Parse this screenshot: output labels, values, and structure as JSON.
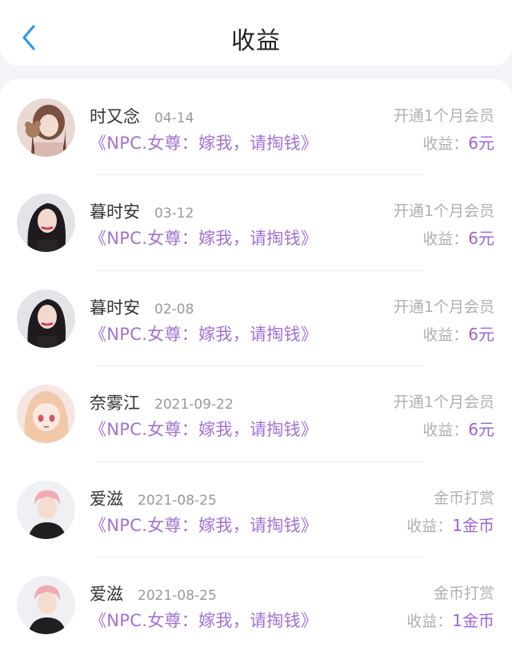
{
  "header": {
    "title": "收益"
  },
  "earn_label": "收益：",
  "records": [
    {
      "name": "时又念",
      "date": "04-14",
      "book": "《NPC.女尊：嫁我，请掏钱》",
      "type": "开通1个月会员",
      "amount": "6元",
      "avatar": "girl-with-teddy-bear"
    },
    {
      "name": "暮时安",
      "date": "03-12",
      "book": "《NPC.女尊：嫁我，请掏钱》",
      "type": "开通1个月会员",
      "amount": "6元",
      "avatar": "dark-hair-girl"
    },
    {
      "name": "暮时安",
      "date": "02-08",
      "book": "《NPC.女尊：嫁我，请掏钱》",
      "type": "开通1个月会员",
      "amount": "6元",
      "avatar": "dark-hair-girl"
    },
    {
      "name": "奈雾江",
      "date": "2021-09-22",
      "book": "《NPC.女尊：嫁我，请掏钱》",
      "type": "开通1个月会员",
      "amount": "6元",
      "avatar": "anime-girl"
    },
    {
      "name": "爱滋",
      "date": "2021-08-25",
      "book": "《NPC.女尊：嫁我，请掏钱》",
      "type": "金币打赏",
      "amount": "1金币",
      "avatar": "pink-hair-boy"
    },
    {
      "name": "爱滋",
      "date": "2021-08-25",
      "book": "《NPC.女尊：嫁我，请掏钱》",
      "type": "金币打赏",
      "amount": "1金币",
      "avatar": "pink-hair-boy"
    }
  ]
}
